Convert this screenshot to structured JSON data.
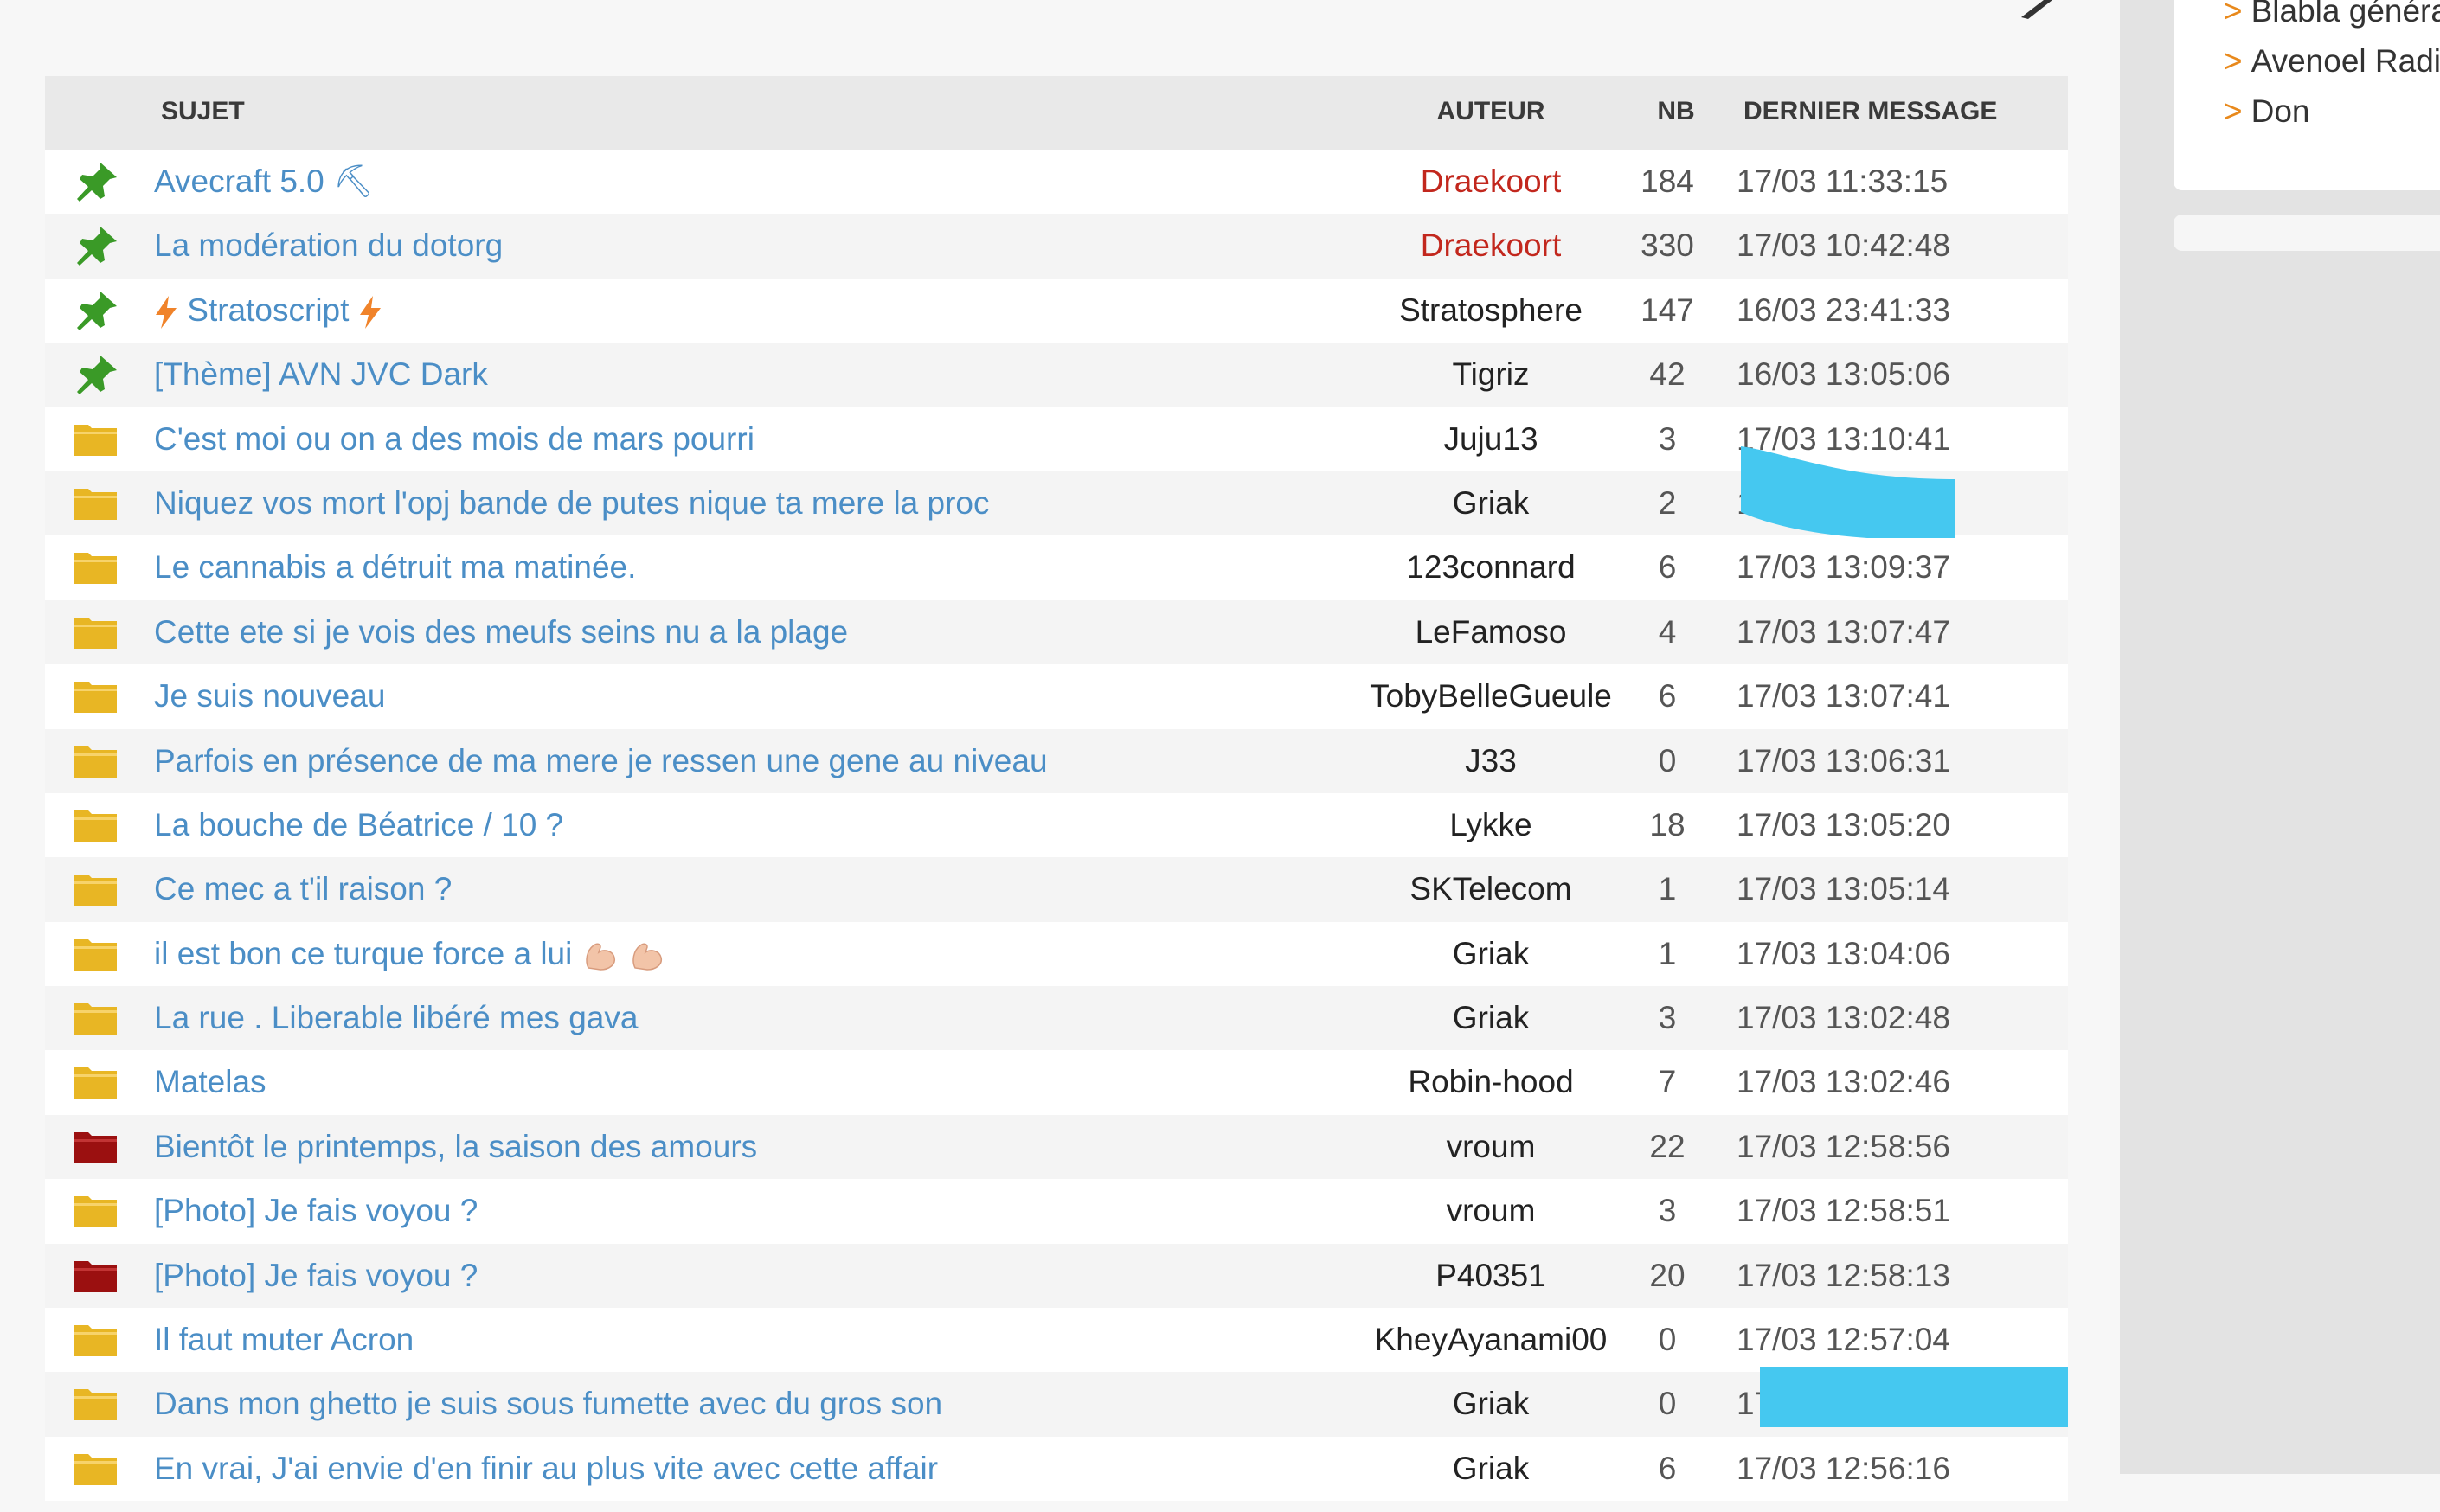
{
  "table": {
    "headers": {
      "sujet": "SUJET",
      "auteur": "AUTEUR",
      "nb": "NB",
      "dernier": "DERNIER MESSAGE"
    },
    "rows": [
      {
        "icon": "pin",
        "title": "Avecraft 5.0 ⛏",
        "author": "Draekoort",
        "mod": true,
        "nb": "184",
        "last": "17/03 11:33:15"
      },
      {
        "icon": "pin",
        "title": "La modération du dotorg",
        "author": "Draekoort",
        "mod": true,
        "nb": "330",
        "last": "17/03 10:42:48"
      },
      {
        "icon": "pin",
        "title": "Stratoscript",
        "author": "Stratosphere",
        "mod": false,
        "nb": "147",
        "last": "16/03 23:41:33"
      },
      {
        "icon": "pin",
        "title": "[Thème] AVN JVC Dark",
        "author": "Tigriz",
        "mod": false,
        "nb": "42",
        "last": "16/03 13:05:06"
      },
      {
        "icon": "folder",
        "title": "C'est moi ou on a des mois de mars pourri",
        "author": "Juju13",
        "mod": false,
        "nb": "3",
        "last": "17/03 13:10:41"
      },
      {
        "icon": "folder",
        "title": "Niquez vos mort l'opj bande de putes nique ta mere la proc",
        "author": "Griak",
        "mod": false,
        "nb": "2",
        "last": "17/03 13:10:40"
      },
      {
        "icon": "folder",
        "title": "Le cannabis a détruit ma matinée.",
        "author": "123connard",
        "mod": false,
        "nb": "6",
        "last": "17/03 13:09:37"
      },
      {
        "icon": "folder",
        "title": "Cette ete si je vois des meufs seins nu a la plage",
        "author": "LeFamoso",
        "mod": false,
        "nb": "4",
        "last": "17/03 13:07:47"
      },
      {
        "icon": "folder",
        "title": "Je suis nouveau",
        "author": "TobyBelleGueule",
        "mod": false,
        "nb": "6",
        "last": "17/03 13:07:41"
      },
      {
        "icon": "folder",
        "title": "Parfois en présence de ma mere je ressen une gene au niveau",
        "author": "J33",
        "mod": false,
        "nb": "0",
        "last": "17/03 13:06:31"
      },
      {
        "icon": "folder",
        "title": "La bouche de Béatrice / 10 ?",
        "author": "Lykke",
        "mod": false,
        "nb": "18",
        "last": "17/03 13:05:20"
      },
      {
        "icon": "folder",
        "title": "Ce mec a t'il raison ?",
        "author": "SKTelecom",
        "mod": false,
        "nb": "1",
        "last": "17/03 13:05:14"
      },
      {
        "icon": "folder",
        "title": "il est bon ce turque force a lui",
        "author": "Griak",
        "mod": false,
        "nb": "1",
        "last": "17/03 13:04:06"
      },
      {
        "icon": "folder",
        "title": "La rue . Liberable libéré mes gava",
        "author": "Griak",
        "mod": false,
        "nb": "3",
        "last": "17/03 13:02:48"
      },
      {
        "icon": "folder",
        "title": "Matelas",
        "author": "Robin-hood",
        "mod": false,
        "nb": "7",
        "last": "17/03 13:02:46"
      },
      {
        "icon": "folder-hot",
        "title": "Bientôt le printemps, la saison des amours",
        "author": "vroum",
        "mod": false,
        "nb": "22",
        "last": "17/03 12:58:56"
      },
      {
        "icon": "folder",
        "title": "[Photo] Je fais voyou ?",
        "author": "vroum",
        "mod": false,
        "nb": "3",
        "last": "17/03 12:58:51"
      },
      {
        "icon": "folder-hot",
        "title": "[Photo] Je fais voyou ?",
        "author": "P40351",
        "mod": false,
        "nb": "20",
        "last": "17/03 12:58:13"
      },
      {
        "icon": "folder",
        "title": "Il faut muter Acron",
        "author": "KheyAyanami00",
        "mod": false,
        "nb": "0",
        "last": "17/03 12:57:04"
      },
      {
        "icon": "folder",
        "title": "Dans mon ghetto je suis sous fumette avec du gros son",
        "author": "Griak",
        "mod": false,
        "nb": "0",
        "last": "17/03 12:56:51"
      },
      {
        "icon": "folder",
        "title": "En vrai, J'ai envie d'en finir au plus vite avec cette affair",
        "author": "Griak",
        "mod": false,
        "nb": "6",
        "last": "17/03 12:56:16"
      }
    ]
  },
  "sidebar": {
    "links": [
      {
        "label": "Blabla généra"
      },
      {
        "label": "Avenoel Radi"
      },
      {
        "label": "Don"
      }
    ]
  },
  "colors": {
    "link": "#4b8ec6",
    "moderator": "#c2271d",
    "pin": "#3a9a27",
    "folder": "#e8b624",
    "folder_hot": "#9b1010",
    "accent_arrow": "#e8891c",
    "highlight": "#45c8f0"
  },
  "icons": {
    "pin": "pin-icon",
    "folder": "folder-icon",
    "folder_hot": "folder-hot-icon",
    "bolt": "lightning-icon",
    "flex": "flexed-biceps-icon",
    "edit": "pencil-icon"
  }
}
